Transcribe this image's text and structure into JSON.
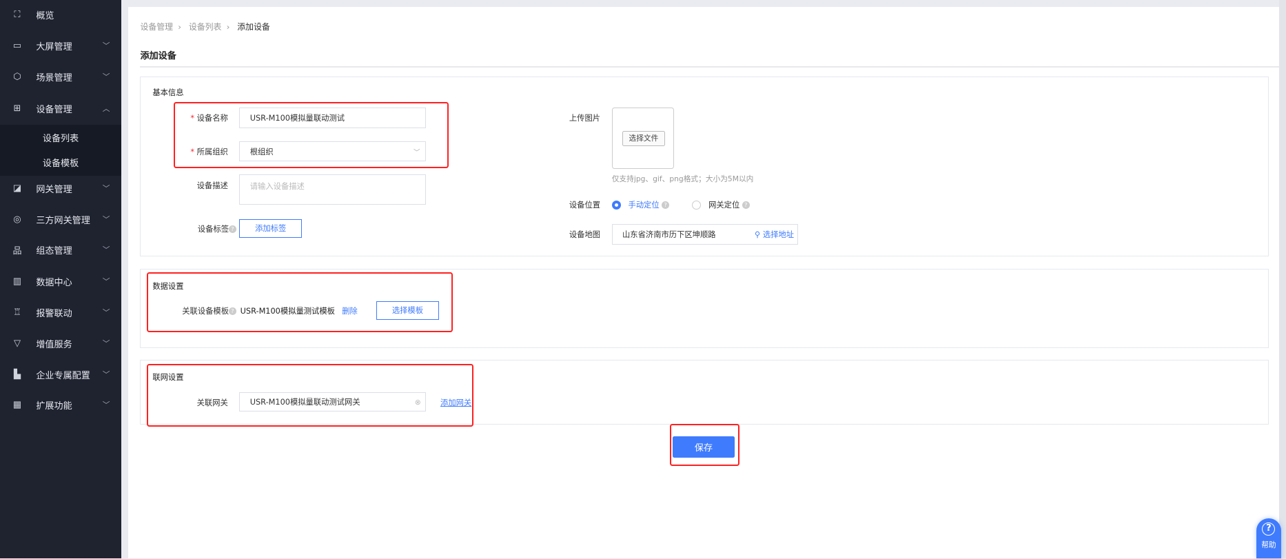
{
  "sidebar": {
    "items": [
      {
        "label": "概览",
        "icon": "overview-icon",
        "glyph": "⛶"
      },
      {
        "label": "大屏管理",
        "icon": "screen-icon",
        "glyph": "▭"
      },
      {
        "label": "场景管理",
        "icon": "scene-icon",
        "glyph": "⬡"
      },
      {
        "label": "设备管理",
        "icon": "device-icon",
        "glyph": "⊞"
      },
      {
        "label": "网关管理",
        "icon": "gateway-icon",
        "glyph": "◪"
      },
      {
        "label": "三方网关管理",
        "icon": "third-party-gateway-icon",
        "glyph": "◎"
      },
      {
        "label": "组态管理",
        "icon": "configuration-icon",
        "glyph": "品"
      },
      {
        "label": "数据中心",
        "icon": "data-center-icon",
        "glyph": "▥"
      },
      {
        "label": "报警联动",
        "icon": "alarm-icon",
        "glyph": "♖"
      },
      {
        "label": "增值服务",
        "icon": "value-added-icon",
        "glyph": "▽"
      },
      {
        "label": "企业专属配置",
        "icon": "enterprise-icon",
        "glyph": "▙"
      },
      {
        "label": "扩展功能",
        "icon": "extension-icon",
        "glyph": "▦"
      }
    ],
    "submenu": [
      "设备列表",
      "设备模板"
    ]
  },
  "breadcrumb": [
    "设备管理",
    "设备列表",
    "添加设备"
  ],
  "page_title": "添加设备",
  "basic": {
    "section": "基本信息",
    "name_label": "设备名称",
    "name_value": "USR-M100模拟量联动测试",
    "org_label": "所属组织",
    "org_value": "根组织",
    "desc_label": "设备描述",
    "desc_placeholder": "请输入设备描述",
    "tag_label": "设备标签",
    "tag_button": "添加标签",
    "upload_label": "上传图片",
    "upload_button": "选择文件",
    "upload_hint": "仅支持jpg、gif、png格式；大小为5M以内",
    "location_label": "设备位置",
    "location_manual": "手动定位",
    "location_gateway": "网关定位",
    "map_label": "设备地图",
    "map_value": "山东省济南市历下区坤顺路",
    "map_button": "选择地址"
  },
  "data_settings": {
    "section": "数据设置",
    "template_label": "关联设备模板",
    "template_value": "USR-M100模拟量测试模板",
    "delete": "删除",
    "choose": "选择模板"
  },
  "network": {
    "section": "联网设置",
    "gateway_label": "关联网关",
    "gateway_value": "USR-M100模拟量联动测试网关",
    "add": "添加网关"
  },
  "save": "保存",
  "help": "帮助",
  "colors": {
    "primary": "#3f7bfd",
    "sidebar": "#1f2330",
    "annotation": "#ff2020"
  }
}
